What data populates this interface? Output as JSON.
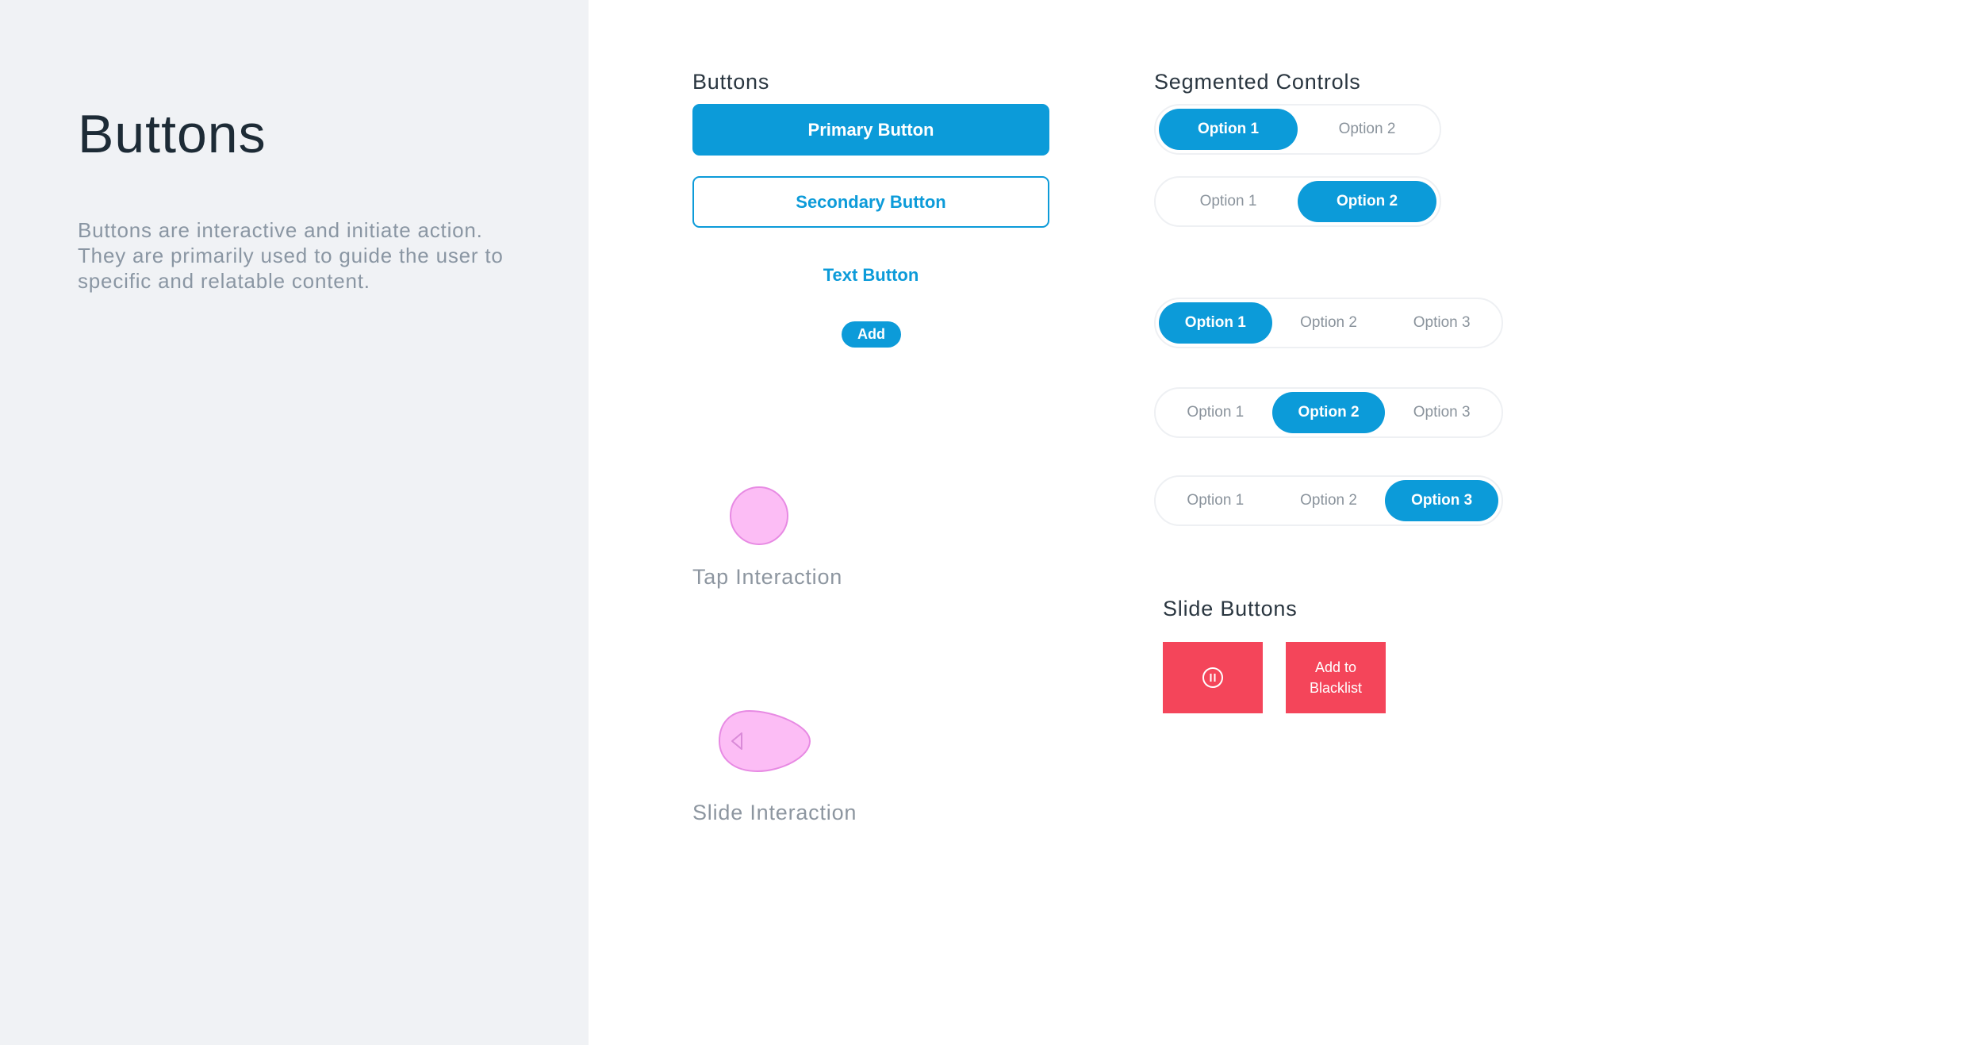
{
  "sidebar": {
    "title": "Buttons",
    "description": "Buttons are interactive and initiate action. They are primarily used to guide the user to specific and relatable content."
  },
  "buttons_section": {
    "title": "Buttons",
    "primary_label": "Primary Button",
    "secondary_label": "Secondary Button",
    "text_label": "Text Button",
    "add_label": "Add"
  },
  "interactions": {
    "tap_label": "Tap Interaction",
    "slide_label": "Slide Interaction"
  },
  "segmented": {
    "title": "Segmented Controls",
    "two_option_a": {
      "options": [
        "Option 1",
        "Option 2"
      ],
      "selected": "Option 1"
    },
    "two_option_b": {
      "options": [
        "Option 1",
        "Option 2"
      ],
      "selected": "Option 2"
    },
    "three_option_a": {
      "options": [
        "Option 1",
        "Option 2",
        "Option 3"
      ],
      "selected": "Option 1"
    },
    "three_option_b": {
      "options": [
        "Option 1",
        "Option 2",
        "Option 3"
      ],
      "selected": "Option 2"
    },
    "three_option_c": {
      "options": [
        "Option 1",
        "Option 2",
        "Option 3"
      ],
      "selected": "Option 3"
    }
  },
  "slide_buttons": {
    "title": "Slide Buttons",
    "pause_icon": "pause-circle-icon",
    "blacklist_label": "Add to Blacklist"
  },
  "colors": {
    "accent": "#0c9bd9",
    "danger": "#f4455a",
    "sidebar_bg": "#f0f2f5",
    "interaction_pink": "#fcbdf5"
  }
}
